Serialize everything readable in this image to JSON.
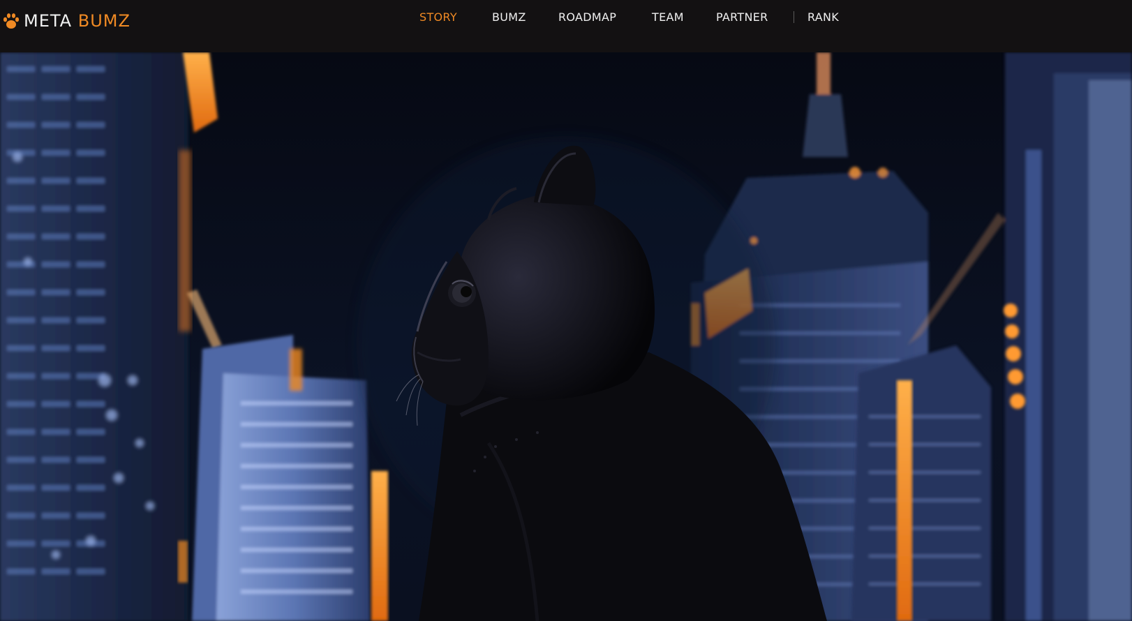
{
  "header": {
    "logo": {
      "icon": "paw-icon",
      "meta": "META",
      "bumz": "BUMZ"
    },
    "nav": [
      {
        "label": "STORY",
        "active": true
      },
      {
        "label": "BUMZ",
        "active": false
      },
      {
        "label": "ROADMAP",
        "active": false
      },
      {
        "label": "TEAM",
        "active": false
      },
      {
        "label": "PARTNER",
        "active": false
      },
      {
        "label": "RANK",
        "active": false
      }
    ]
  },
  "colors": {
    "accent": "#f08a24",
    "header_bg": "#131112",
    "nav_text": "#f0f0f0"
  },
  "hero": {
    "scene": "hooded-cat-figure-night-city"
  }
}
